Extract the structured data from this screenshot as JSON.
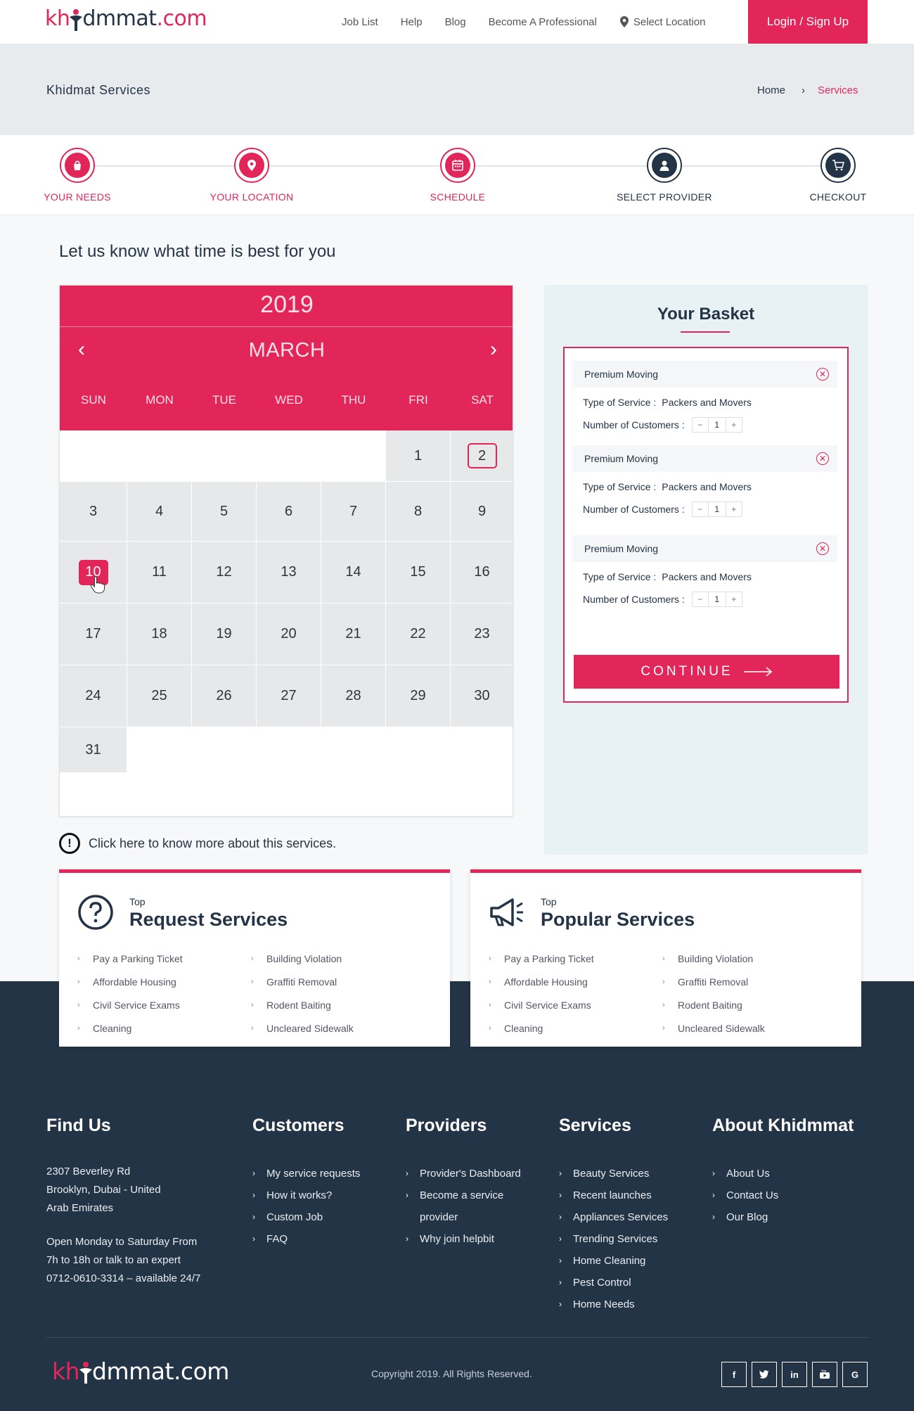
{
  "brand": {
    "part1": "kh",
    "part2": "dmmat",
    "part3": ".com",
    "color": "#e3265a",
    "dark": "#243447"
  },
  "nav": {
    "links": [
      "Job List",
      "Help",
      "Blog",
      "Become A Professional"
    ],
    "location": "Select Location",
    "login": "Login / Sign Up"
  },
  "breadcrumb": {
    "title": "Khidmat Services",
    "home": "Home",
    "separator": "›",
    "current": "Services"
  },
  "steps": [
    {
      "label": "YOUR NEEDS",
      "icon": "shopping-bag-icon",
      "state": "done"
    },
    {
      "label": "YOUR LOCATION",
      "icon": "map-pin-icon",
      "state": "done"
    },
    {
      "label": "SCHEDULE",
      "icon": "calendar-icon",
      "state": "active"
    },
    {
      "label": "SELECT PROVIDER",
      "icon": "user-icon",
      "state": "pending"
    },
    {
      "label": "CHECKOUT",
      "icon": "cart-icon",
      "state": "pending"
    }
  ],
  "schedule": {
    "heading": "Let us know what time is best for you",
    "year": "2019",
    "month": "MARCH",
    "weekdays": [
      "SUN",
      "MON",
      "TUE",
      "WED",
      "THU",
      "FRI",
      "SAT"
    ],
    "days": [
      "1",
      "2",
      "3",
      "4",
      "5",
      "6",
      "7",
      "8",
      "9",
      "10",
      "11",
      "12",
      "13",
      "14",
      "15",
      "16",
      "17",
      "18",
      "19",
      "20",
      "21",
      "22",
      "23",
      "24",
      "25",
      "26",
      "27",
      "28",
      "29",
      "30",
      "31"
    ],
    "today": "2",
    "selected": "10",
    "info": "Click here to know more about this services."
  },
  "basket": {
    "title": "Your Basket",
    "items": [
      {
        "name": "Premium Moving",
        "type_label": "Type of Service :",
        "type_value": "Packers and Movers",
        "count_label": "Number of Customers :",
        "count": "1"
      },
      {
        "name": "Premium Moving",
        "type_label": "Type of Service :",
        "type_value": "Packers and Movers",
        "count_label": "Number of Customers :",
        "count": "1"
      },
      {
        "name": "Premium Moving",
        "type_label": "Type of Service :",
        "type_value": "Packers and Movers",
        "count_label": "Number of Customers :",
        "count": "1"
      }
    ],
    "continue": "CONTINUE"
  },
  "service_cards": [
    {
      "top": "Top",
      "title": "Request Services",
      "icon": "question-circle-icon",
      "left_items": [
        "Pay a Parking Ticket",
        "Affordable Housing",
        "Civil Service Exams",
        "Cleaning"
      ],
      "right_items": [
        "Building Violation",
        "Graffiti Removal",
        "Rodent Baiting",
        "Uncleared Sidewalk"
      ]
    },
    {
      "top": "Top",
      "title": "Popular Services",
      "icon": "megaphone-icon",
      "left_items": [
        "Pay a Parking Ticket",
        "Affordable Housing",
        "Civil Service Exams",
        "Cleaning"
      ],
      "right_items": [
        "Building Violation",
        "Graffiti Removal",
        "Rodent Baiting",
        "Uncleared Sidewalk"
      ]
    }
  ],
  "footer": {
    "find_us": {
      "title": "Find Us",
      "address": [
        "2307 Beverley Rd",
        "Brooklyn, Dubai - United",
        "Arab Emirates"
      ],
      "hours": [
        "Open Monday to Saturday From",
        "7h to 18h or talk to an expert",
        "0712-0610-3314 – available 24/7"
      ]
    },
    "customers": {
      "title": "Customers",
      "items": [
        "My service requests",
        "How it works?",
        "Custom Job",
        "FAQ"
      ]
    },
    "providers": {
      "title": "Providers",
      "items": [
        "Provider's Dashboard",
        "Become a service",
        "provider",
        "Why join helpbit"
      ]
    },
    "services": {
      "title": "Services",
      "items": [
        "Beauty Services",
        "Recent launches",
        "Appliances Services",
        "Trending Services",
        "Home Cleaning",
        "Pest Control",
        "Home Needs"
      ]
    },
    "about": {
      "title": "About Khidmmat",
      "items": [
        "About Us",
        "Contact Us",
        "Our Blog"
      ]
    },
    "copyright": "Copyright 2019. All Rights Reserved.",
    "socials": [
      "f",
      "t",
      "in",
      "yt",
      "G"
    ]
  }
}
